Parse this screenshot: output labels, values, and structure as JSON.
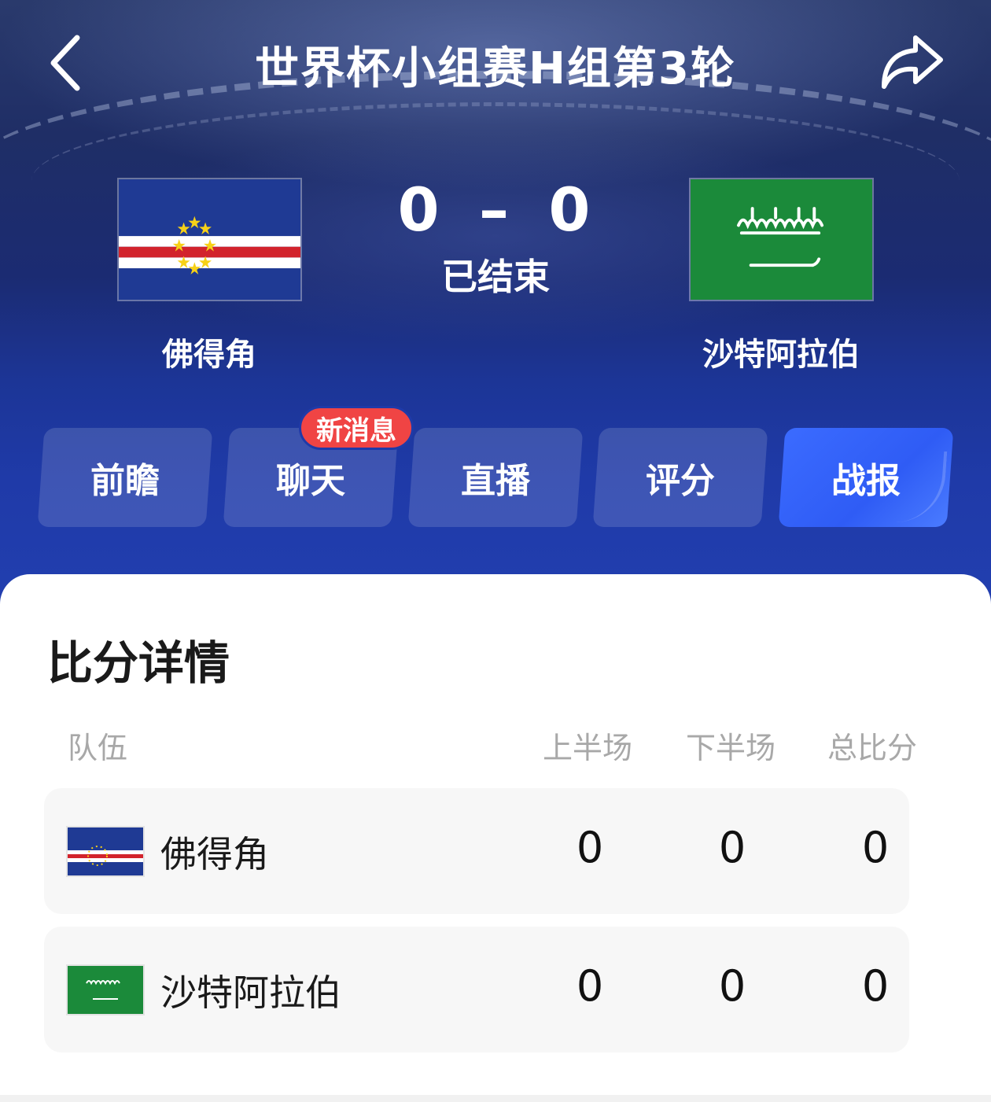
{
  "header": {
    "title": "世界杯小组赛H组第3轮",
    "back_icon": "chevron-left-icon",
    "share_icon": "share-arrow-icon"
  },
  "match": {
    "home": {
      "name": "佛得角",
      "flag": "cape-verde-flag"
    },
    "away": {
      "name": "沙特阿拉伯",
      "flag": "saudi-arabia-flag"
    },
    "home_score": "0",
    "dash": "–",
    "away_score": "0",
    "status": "已结束"
  },
  "tabs": [
    {
      "label": "前瞻",
      "active": false
    },
    {
      "label": "聊天",
      "active": false
    },
    {
      "label": "直播",
      "active": false
    },
    {
      "label": "评分",
      "active": false
    },
    {
      "label": "战报",
      "active": true
    }
  ],
  "badge": {
    "label": "新消息"
  },
  "score_detail": {
    "title": "比分详情",
    "columns": [
      "队伍",
      "上半场",
      "下半场",
      "总比分"
    ],
    "rows": [
      {
        "team": "佛得角",
        "first_half": "0",
        "second_half": "0",
        "total": "0"
      },
      {
        "team": "沙特阿拉伯",
        "first_half": "0",
        "second_half": "0",
        "total": "0"
      }
    ]
  },
  "colors": {
    "header_bg": "#1f3aa8",
    "active_tab": "#3b6bff",
    "badge": "#f04444",
    "panel_bg": "#ffffff",
    "row_bg": "#f7f7f7"
  }
}
